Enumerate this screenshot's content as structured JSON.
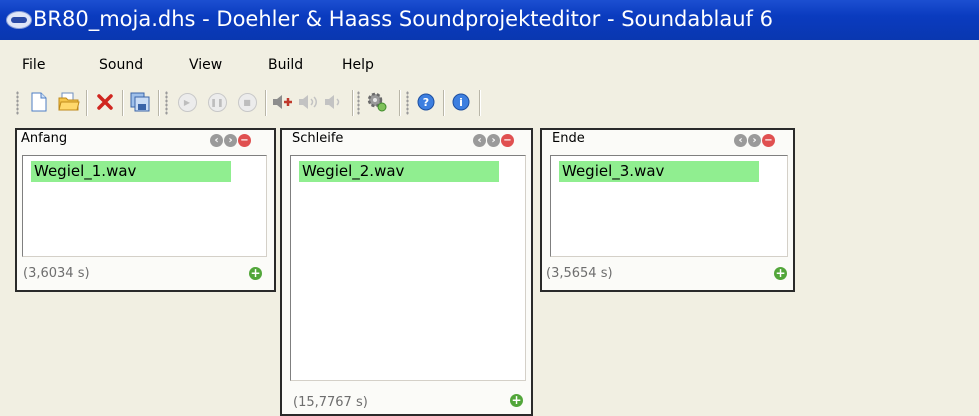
{
  "window": {
    "title": "BR80_moja.dhs - Doehler & Haass Soundprojekteditor - Soundablauf 6"
  },
  "menu": [
    "File",
    "Sound",
    "View",
    "Build",
    "Help"
  ],
  "toolbar": {
    "buttons": [
      "new-file-icon",
      "open-folder-icon",
      "delete-icon",
      "save-as-icon",
      "play-icon",
      "pause-icon",
      "stop-icon",
      "volume-up-icon",
      "volume-mid-icon",
      "volume-down-icon",
      "settings-icon",
      "help-icon",
      "info-icon"
    ]
  },
  "panels": [
    {
      "title": "Anfang",
      "file": "Wegiel_1.wav",
      "duration": "(3,6034 s)"
    },
    {
      "title": "Schleife",
      "file": "Wegiel_2.wav",
      "duration": "(15,7767 s)"
    },
    {
      "title": "Ende",
      "file": "Wegiel_3.wav",
      "duration": "(3,5654 s)"
    }
  ],
  "colors": {
    "titlebar": "#0a3bbf",
    "item_highlight": "#90ee90",
    "add_button": "#52a63a",
    "remove_button": "#e05050"
  }
}
